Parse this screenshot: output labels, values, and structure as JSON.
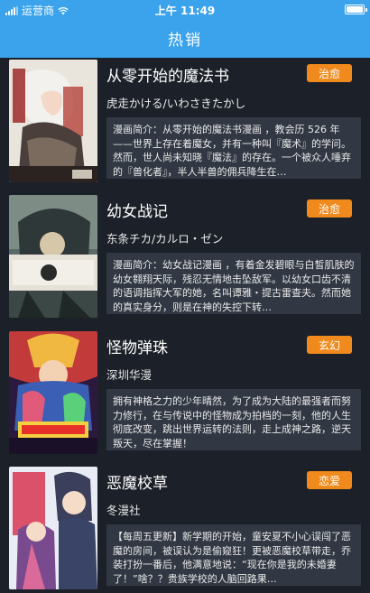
{
  "status_bar": {
    "carrier": "运营商",
    "time": "上午 11:49"
  },
  "nav": {
    "title": "热销"
  },
  "comics": [
    {
      "title": "从零开始的魔法书",
      "tag": "治愈",
      "author": "虎走かける/いわさきたかし",
      "description": "漫画简介：从零开始的魔法书漫画 ，教会历 526 年——世界上存在着魔女，并有一种叫『魔术』的学问。然而，世人尚未知晓『魔法』的存在。一个被众人唾弃的『兽化者』，半人半兽的佣兵降生在…",
      "accent": "#f08a1c"
    },
    {
      "title": "幼女战记",
      "tag": "治愈",
      "author": "东条チカ/カルロ・ゼン",
      "description": "漫画简介：幼女战记漫画 ，有着金发碧眼与白皙肌肤的幼女翱翔天际，残忍无情地击坠敌军。以幼女口齿不清的语调指挥大军的她，名叫谭雅・提古雷查夫。然而她的真实身分，则是在神的失控下转…",
      "accent": "#f08a1c"
    },
    {
      "title": "怪物弹珠",
      "tag": "玄幻",
      "author": "深圳华漫",
      "description": "拥有神格之力的少年晴然，为了成为大陆的最强者而努力修行，在与传说中的怪物成为拍档的一刻，他的人生彻底改变，跳出世界运转的法则，走上成神之路，逆天叛天，尽在掌握！",
      "accent": "#f08a1c"
    },
    {
      "title": "恶魔校草",
      "tag": "恋爱",
      "author": "冬漫社",
      "description": "【每周五更新】新学期的开始，童安夏不小心误闯了恶魔的房间，被误认为是偷窥狂！更被恶魔校草带走，乔装打扮一番后，他满意地说：“现在你是我的未婚妻了！”啥？？贵族学校的人脑回路果…",
      "accent": "#f08a1c"
    }
  ]
}
